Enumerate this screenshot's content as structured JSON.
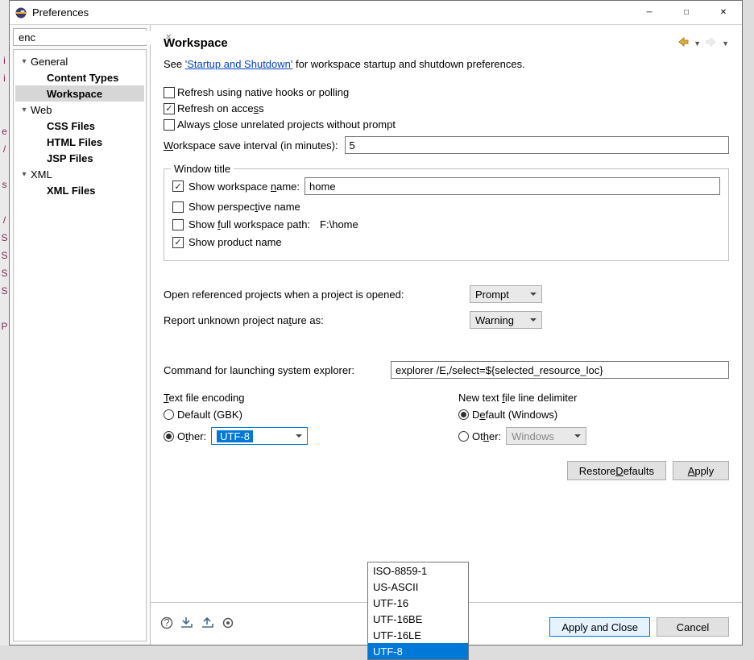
{
  "window": {
    "title": "Preferences"
  },
  "search": {
    "value": "enc"
  },
  "tree": {
    "general": {
      "label": "General",
      "expanded": true
    },
    "contentTypes": {
      "label": "Content Types",
      "bold": true
    },
    "workspace": {
      "label": "Workspace",
      "bold": true
    },
    "web": {
      "label": "Web",
      "expanded": true
    },
    "cssfiles": {
      "label": "CSS Files",
      "bold": true
    },
    "htmlfiles": {
      "label": "HTML Files",
      "bold": true
    },
    "jspfiles": {
      "label": "JSP Files",
      "bold": true
    },
    "xml": {
      "label": "XML",
      "expanded": true
    },
    "xmlfiles": {
      "label": "XML Files",
      "bold": true
    }
  },
  "page": {
    "title": "Workspace",
    "see_prefix": "See ",
    "see_link": "'Startup and Shutdown'",
    "see_suffix": " for workspace startup and shutdown preferences.",
    "refresh_native_label": "Refresh using native hooks or polling",
    "refresh_native_checked": false,
    "refresh_access_label": "Refresh on access",
    "refresh_access_checked": true,
    "always_close_label": "Always close unrelated projects without prompt",
    "always_close_checked": false,
    "save_interval_prefix": "W",
    "save_interval_label": "orkspace save interval (in minutes):",
    "save_interval_value": "5",
    "window_title_legend": "Window title",
    "wt_workspace_checked": true,
    "wt_workspace_prefix": "Show workspace ",
    "wt_workspace_u": "n",
    "wt_workspace_suffix": "ame:",
    "wt_workspace_value": "home",
    "wt_perspective_checked": false,
    "wt_perspective_prefix": "Show perspec",
    "wt_perspective_u": "t",
    "wt_perspective_suffix": "ive name",
    "wt_fullpath_checked": false,
    "wt_fullpath_prefix": "Show ",
    "wt_fullpath_u": "f",
    "wt_fullpath_mid": "ull workspace path:",
    "wt_fullpath_value": "F:\\home",
    "wt_product_checked": true,
    "wt_product_label": "Show product name",
    "open_ref_label": "Open referenced projects when a project is opened:",
    "open_ref_value": "Prompt",
    "report_nature_prefix": "Report unknown project na",
    "report_nature_u": "t",
    "report_nature_suffix": "ure as:",
    "report_nature_value": "Warning",
    "explorer_label": "Command for launching system explorer:",
    "explorer_value": "explorer /E,/select=${selected_resource_loc}",
    "enc_legend_u": "T",
    "enc_legend": "ext file encoding",
    "enc_default": "Default (GBK)",
    "enc_other_prefix": "O",
    "enc_other_u": "t",
    "enc_other_suffix": "her:",
    "enc_value": "UTF-8",
    "enc_options": [
      "ISO-8859-1",
      "US-ASCII",
      "UTF-16",
      "UTF-16BE",
      "UTF-16LE",
      "UTF-8"
    ],
    "enc_selected_index": 5,
    "ld_legend_prefix": "New text ",
    "ld_legend_u": "f",
    "ld_legend_suffix": "ile line delimiter",
    "ld_default_prefix": "D",
    "ld_default_u": "e",
    "ld_default_suffix": "fault (Windows)",
    "ld_other_prefix": "Ot",
    "ld_other_u": "h",
    "ld_other_suffix": "er:",
    "ld_other_value": "Windows",
    "restore_defaults_prefix": "Restore ",
    "restore_defaults_u": "D",
    "restore_defaults_suffix": "efaults",
    "apply_u": "A",
    "apply_suffix": "pply",
    "apply_close": "Apply and Close",
    "cancel": "Cancel"
  }
}
